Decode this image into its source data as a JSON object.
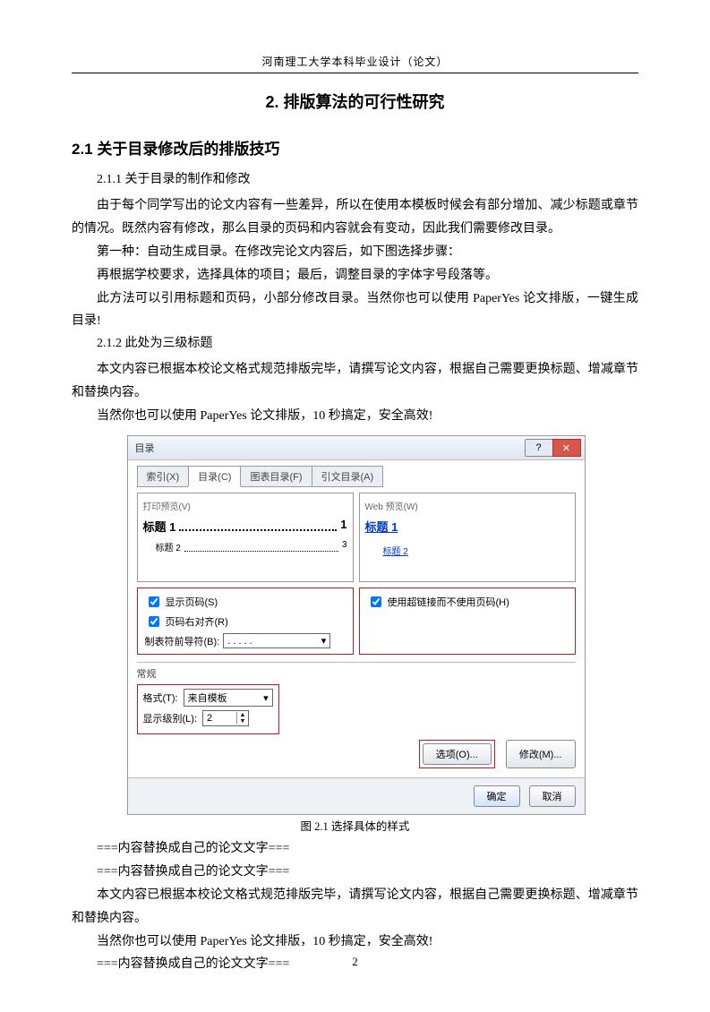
{
  "header": "河南理工大学本科毕业设计（论文）",
  "page_number": "2",
  "h1": "2. 排版算法的可行性研究",
  "h2": "2.1  关于目录修改后的排版技巧",
  "h3_1": "2.1.1  关于目录的制作和修改",
  "p1": "由于每个同学写出的论文内容有一些差异，所以在使用本模板时候会有部分增加、减少标题或章节的情况。既然内容有修改，那么目录的页码和内容就会有变动，因此我们需要修改目录。",
  "p2": "第一种：自动生成目录。在修改完论文内容后，如下图选择步骤：",
  "p3": "再根据学校要求，选择具体的项目；最后，调整目录的字体字号段落等。",
  "p4": "此方法可以引用标题和页码，小部分修改目录。当然你也可以使用 PaperYes 论文排版，一键生成目录!",
  "h3_2": "2.1.2  此处为三级标题",
  "p5": "本文内容已根据本校论文格式规范排版完毕，请撰写论文内容，根据自己需要更换标题、增减章节和替换内容。",
  "p6": "当然你也可以使用 PaperYes 论文排版，10 秒搞定，安全高效!",
  "fig_caption": "图 2.1  选择具体的样式",
  "p7": "===内容替换成自己的论文文字===",
  "p8": "===内容替换成自己的论文文字===",
  "p9": "本文内容已根据本校论文格式规范排版完毕，请撰写论文内容，根据自己需要更换标题、增减章节和替换内容。",
  "p10": "当然你也可以使用 PaperYes 论文排版，10 秒搞定，安全高效!",
  "p11": "===内容替换成自己的论文文字===",
  "dialog": {
    "title": "目录",
    "tabs": [
      "索引(X)",
      "目录(C)",
      "图表目录(F)",
      "引文目录(A)"
    ],
    "left_lbl": "打印预览(V)",
    "right_lbl": "Web 预览(W)",
    "toc1": "标题 1",
    "toc1_pg": "1",
    "toc2": "标题 2",
    "toc2_pg": "3",
    "web1": "标题 1",
    "web2": "标题 2",
    "chk_pagenum": "显示页码(S)",
    "chk_ralign": "页码右对齐(R)",
    "chk_hyper": "使用超链接而不使用页码(H)",
    "leader_lbl": "制表符前导符(B):",
    "leader_val": ". . . . .",
    "general": "常规",
    "format_lbl": "格式(T):",
    "format_val": "来自模板",
    "levels_lbl": "显示级别(L):",
    "levels_val": "2",
    "btn_options": "选项(O)...",
    "btn_modify": "修改(M)...",
    "btn_ok": "确定",
    "btn_cancel": "取消"
  }
}
